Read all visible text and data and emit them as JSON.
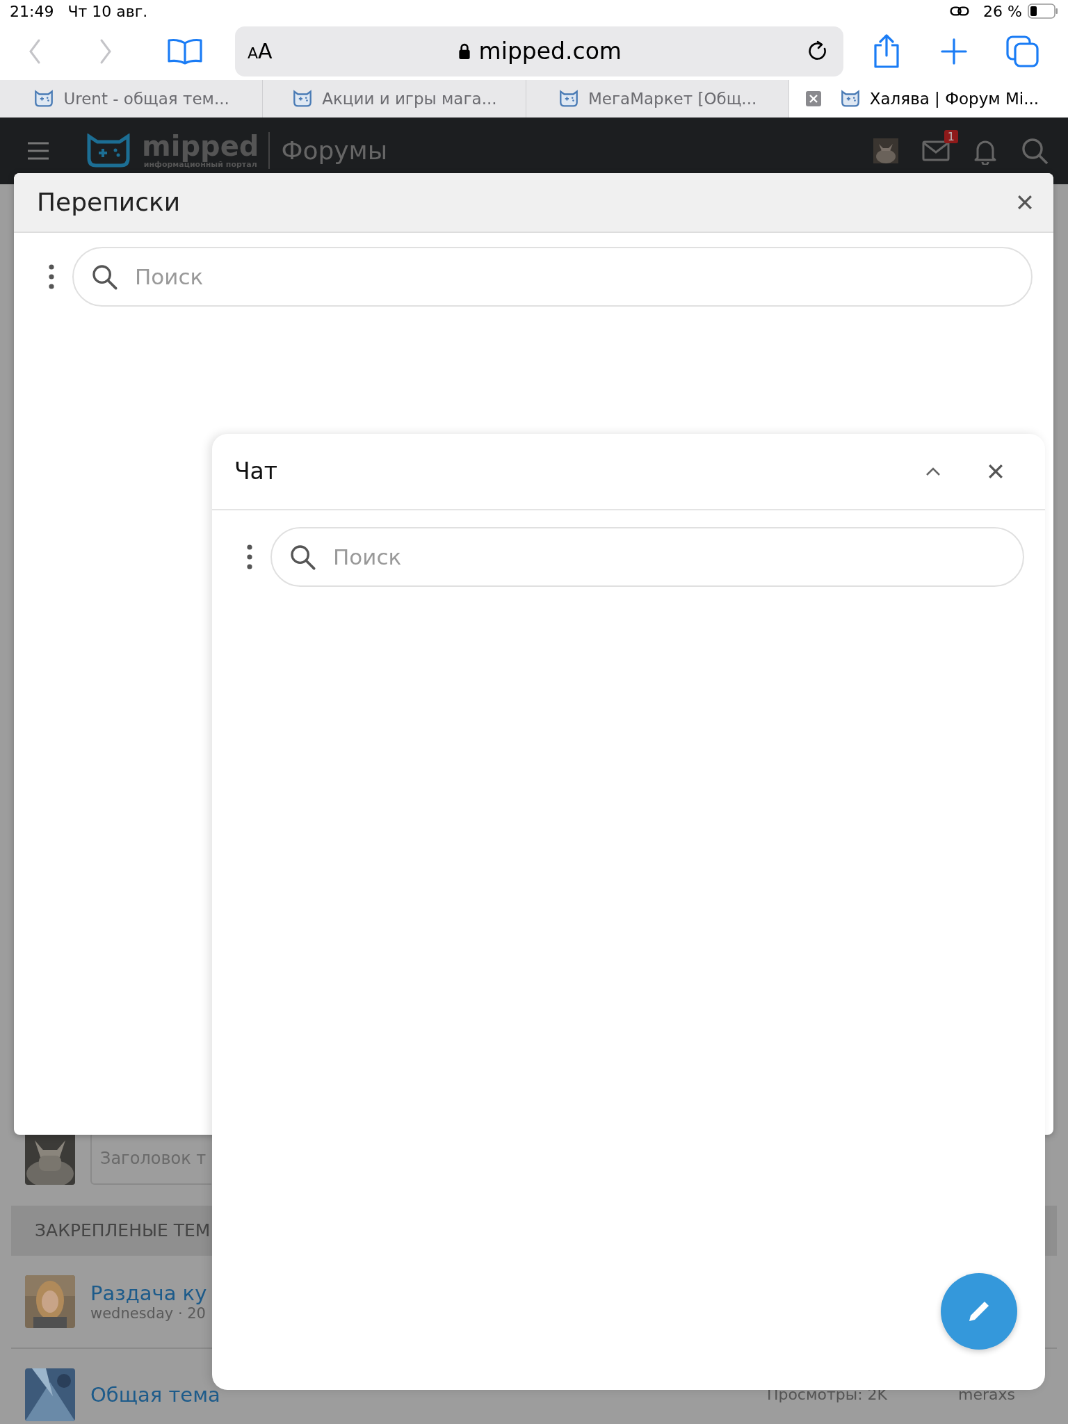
{
  "status_bar": {
    "time": "21:49",
    "date": "Чт 10 авг.",
    "battery": "26 %"
  },
  "browser": {
    "text_size_button": "AA",
    "url": "mipped.com"
  },
  "tabs": [
    {
      "title": "Urent - общая тем...",
      "selected": false
    },
    {
      "title": "Акции и игры мага...",
      "selected": false
    },
    {
      "title": "МегаМаркет [Общ...",
      "selected": false
    },
    {
      "title": "Халява | Форум Mi...",
      "selected": true
    }
  ],
  "forum_header": {
    "logo_text": "mipped",
    "logo_tagline": "информационный портал",
    "section": "Форумы",
    "unread_messages": "1"
  },
  "background_page": {
    "thread_title_placeholder": "Заголовок т",
    "pinned_heading": "ЗАКРЕПЛЕНЫЕ ТЕМ",
    "threads": [
      {
        "title": "Раздача ку",
        "meta": "wednesday · 20"
      },
      {
        "title": "Общая тема"
      }
    ],
    "views": "Просмотры: 2K",
    "author": "meraxs"
  },
  "conversations_dialog": {
    "title": "Переписки",
    "search_placeholder": "Поиск"
  },
  "chat_panel": {
    "title": "Чат",
    "search_placeholder": "Поиск"
  }
}
